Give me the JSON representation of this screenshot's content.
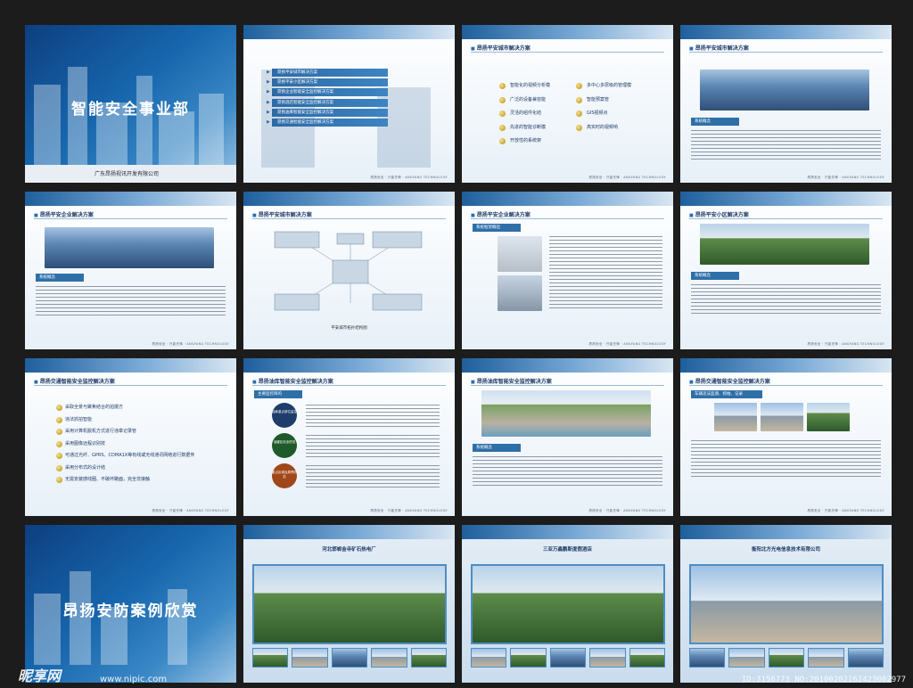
{
  "cover1": {
    "title": "智能安全事业部",
    "company": "广东昂扬视讯开发有限公司"
  },
  "menu": [
    "昂扬平安城市解决方案",
    "昂扬平安小区解决方案",
    "昂扬企业智能安全监控解决方案",
    "昂扬酒店智能安全监控解决方案",
    "昂扬油库智能安全监控解决方案",
    "昂扬交通智能安全监控解决方案"
  ],
  "page3": {
    "title": "昂扬平安城市解决方案",
    "left": [
      "智能化的视频分析模",
      "广泛的设备兼容能",
      "灵活的组件化结",
      "先进的智能诊断模",
      "开放性的系统架"
    ],
    "right": [
      "多中心多层级的管理模",
      "智能预案管",
      "GIS视频点",
      "高实时的视频响"
    ]
  },
  "page4": {
    "title": "昂扬平安城市解决方案",
    "sub": "系统概念"
  },
  "page5": {
    "title": "昂扬平安企业解决方案",
    "sub": "系统概念"
  },
  "page6": {
    "title": "昂扬平安城市解决方案",
    "caption": "平安城市拓扑结构图"
  },
  "page7": {
    "title": "昂扬平安企业解决方案",
    "sub": "系统框架概括"
  },
  "page8": {
    "title": "昂扬平安小区解决方案",
    "sub": "系统概念"
  },
  "page9": {
    "title": "昂扬交通智能安全监控解决方案",
    "items": [
      "采取全景与聚焦结合的拍摄方",
      "违法抓拍智能",
      "采用计算机脱机方式进行违章记录管",
      "采用图像远程识别技",
      "可通过光纤、GPRS、CDMA1X等有线或无线通讯网络进行数据传",
      "采用分布式的设计结",
      "无需安装感线圈、不破坏路面，完全非接触"
    ]
  },
  "page10": {
    "title": "昂扬油库智能安全监控解决方案",
    "sub": "主要监控目的",
    "circles": [
      "油库重点部位监控",
      "油罐区安全防范",
      "重点区域及周界防范"
    ]
  },
  "page11": {
    "title": "昂扬油库智能安全监控解决方案",
    "sub": "系统概念"
  },
  "page12": {
    "title": "昂扬交通智能安全监控解决方案",
    "sub": "车辆违法监测、抓拍、记录"
  },
  "cover2": {
    "title": "昂扬安防案例欣赏"
  },
  "case1": {
    "title": "河北邯郸金寺矿石热电厂"
  },
  "case2": {
    "title": "三亚万鑫鹏斯度假酒店"
  },
  "case3": {
    "title": "衡阳北方光电信息技术有限公司"
  },
  "footer_text": "昂扬安全 · 只能先锋 · ANGYANG TECHNOLOGY",
  "watermark": {
    "logo": "昵享网",
    "url": "www.nipic.com",
    "id": "ID:3156773 NO:20100202162423002977"
  }
}
